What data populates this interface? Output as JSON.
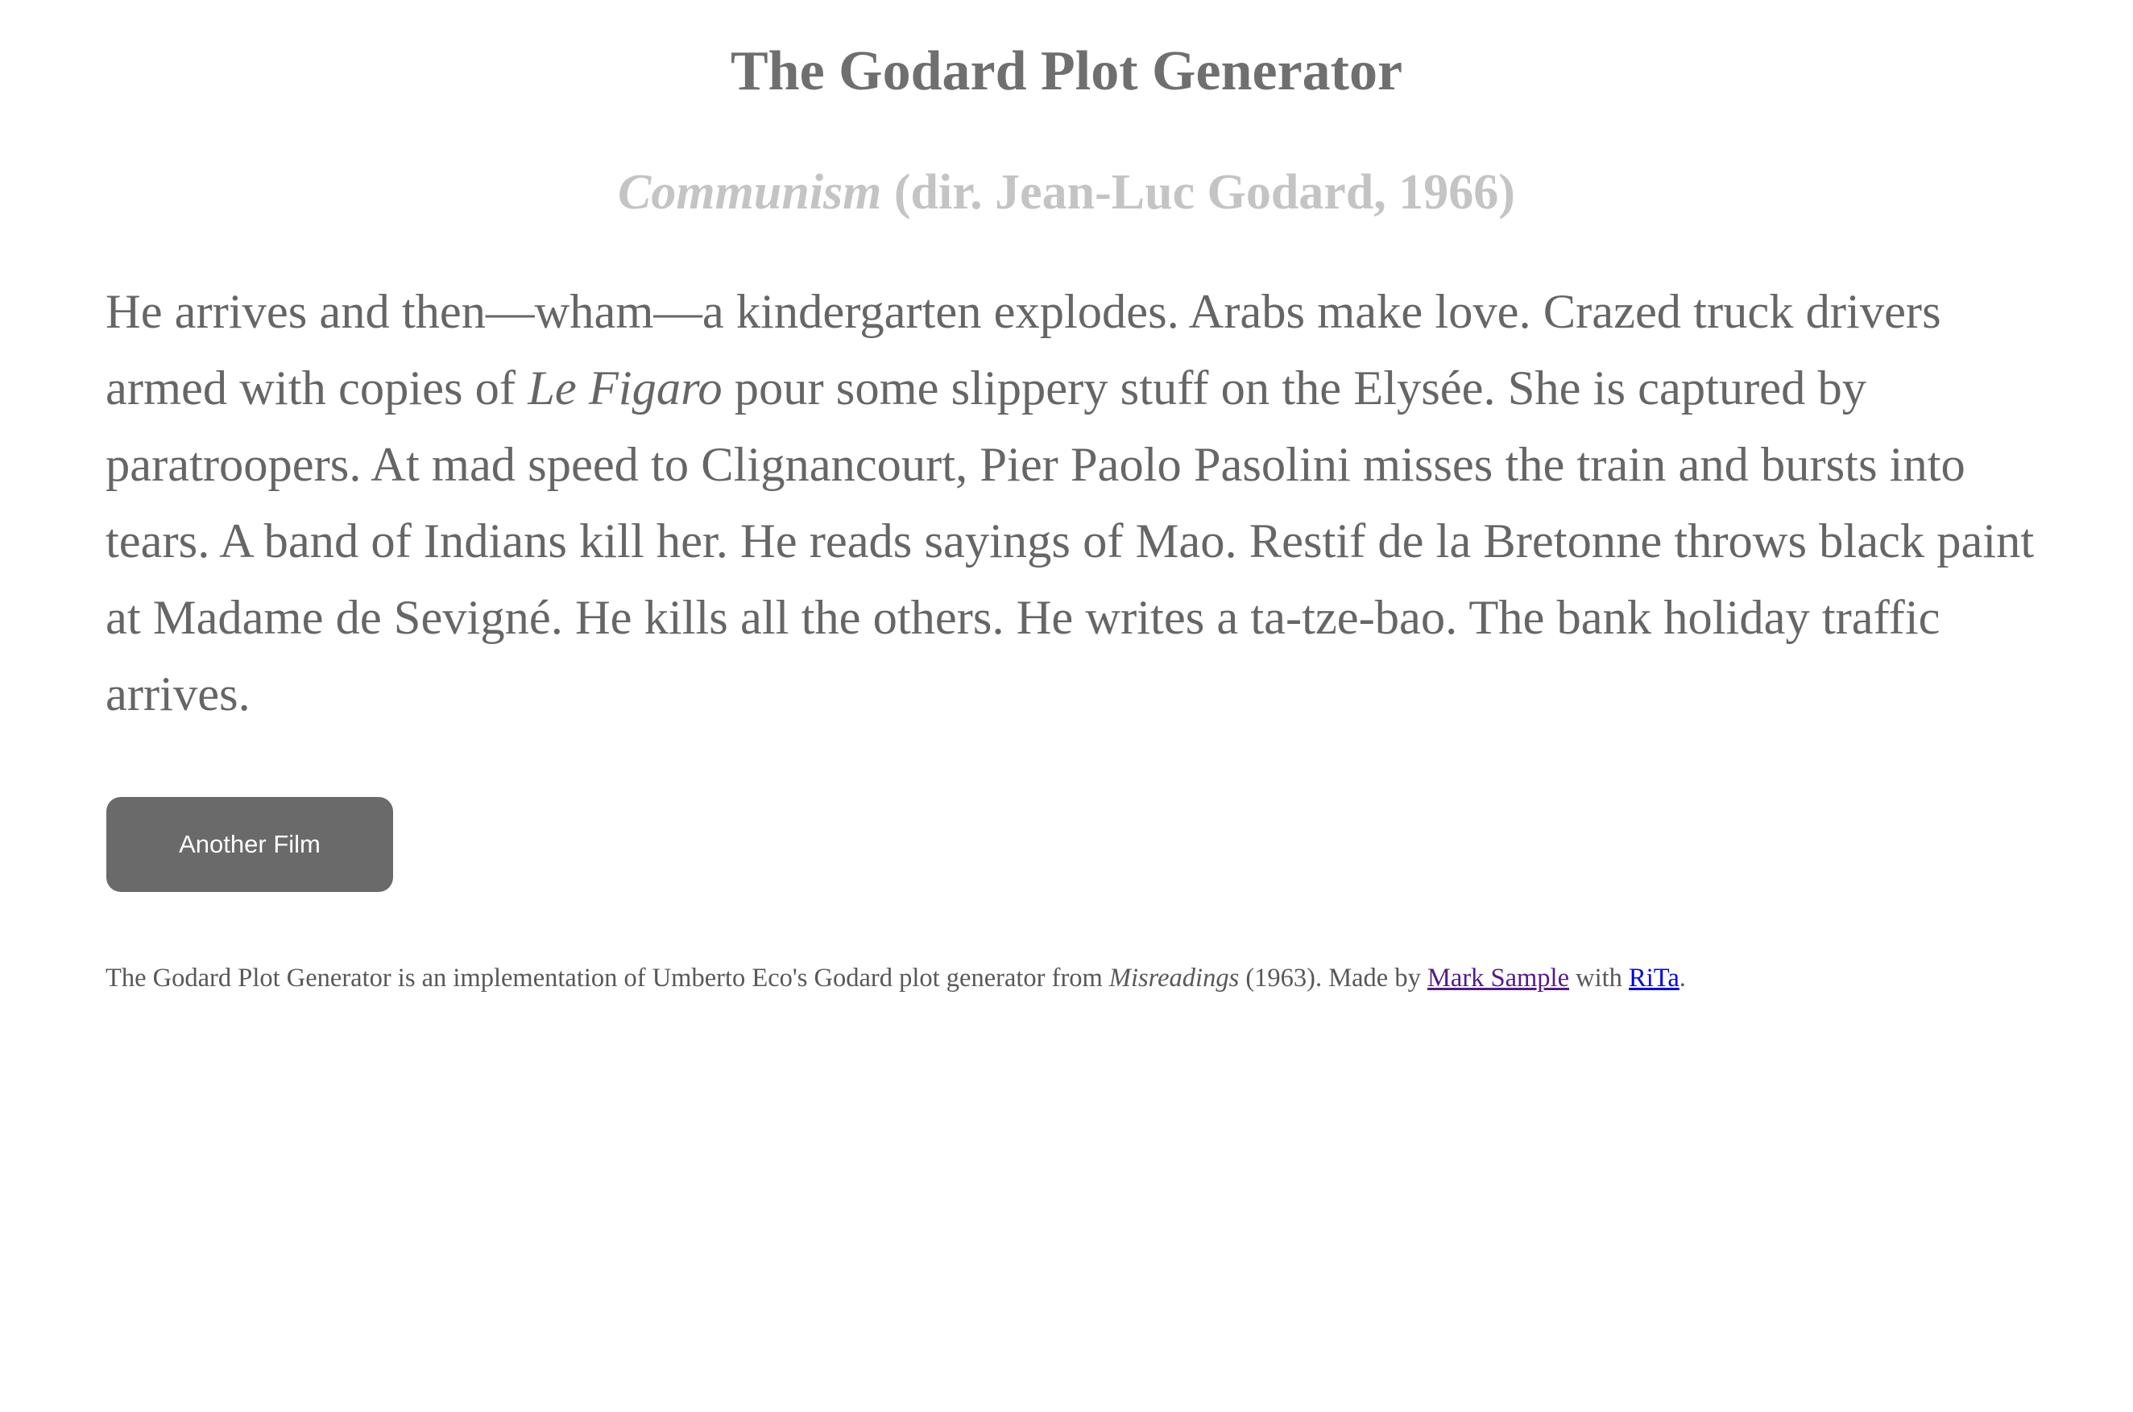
{
  "header": {
    "title": "The Godard Plot Generator"
  },
  "film": {
    "title": "Communism",
    "credit": "(dir. Jean-Luc Godard, 1966)"
  },
  "plot": {
    "part1": "He arrives and then—wham—a kindergarten explodes. Arabs make love. Crazed truck drivers armed with copies of ",
    "italic": "Le Figaro",
    "part2": " pour some slippery stuff on the Elysée. She is captured by paratroopers. At mad speed to Clignancourt, Pier Paolo Pasolini misses the train and bursts into tears. A band of Indians kill her. He reads sayings of Mao. Restif de la Bretonne throws black paint at Madame de Sevigné. He kills all the others. He writes a ta-tze-bao. The bank holiday traffic arrives."
  },
  "controls": {
    "another_label": "Another Film"
  },
  "footer": {
    "text_before": "The Godard Plot Generator is an implementation of Umberto Eco's Godard plot generator from ",
    "book_title": "Misreadings",
    "text_middle": " (1963). Made by ",
    "author_link": "Mark Sample",
    "text_with": " with ",
    "rita_link": "RiTa",
    "text_end": "."
  },
  "colors": {
    "title": "#6f6f6f",
    "film_heading": "#c4c4c4",
    "plot_text": "#666666",
    "button_bg": "#6a6a6a",
    "visited_link": "#551a8b",
    "link": "#0000ee"
  }
}
